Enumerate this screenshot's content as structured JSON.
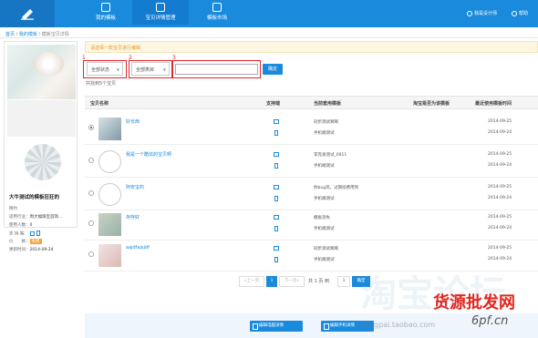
{
  "nav": {
    "items": [
      {
        "label": "我的模板"
      },
      {
        "label": "宝贝详情管理"
      },
      {
        "label": "模板市场"
      }
    ],
    "right": [
      {
        "label": "我是设计师"
      },
      {
        "label": "帮助"
      }
    ]
  },
  "breadcrumb": {
    "items": [
      "首页",
      "我的模板",
      "模板宝贝详情"
    ],
    "sep": "/"
  },
  "template_card": {
    "title": "大牛测试的模板狂狂的",
    "subtitle": "简约",
    "meta": [
      {
        "label": "适用行业：",
        "value": "周大福珠宝首饰..."
      },
      {
        "label": "使用人数：",
        "value": "0"
      },
      {
        "label": "支 持 端：",
        "value": ""
      },
      {
        "label": "价　　格：",
        "value": "免费"
      },
      {
        "label": "更新时间：",
        "value": "2014-09-24"
      }
    ]
  },
  "notice": "请选择一款宝贝进行编辑",
  "filters": {
    "status": "全部状态",
    "category": "全部类目",
    "search_placeholder": "",
    "ok_label": "确定",
    "annotations": [
      "1",
      "2",
      "3"
    ]
  },
  "count_text": "共找到5个宝贝",
  "table": {
    "headers": [
      "宝贝名称",
      "支持端",
      "当前套用模板",
      "淘宝是否为该模板",
      "最近使用模板时间"
    ],
    "rows": [
      {
        "name": "好长西",
        "selected": true,
        "tpl_pc": "同步测试啊啊",
        "tpl_mobile": "手机端测试",
        "date_pc": "2014-09-25",
        "date_mobile": "2014-09-24"
      },
      {
        "name": "我是一个酷炫的宝贝啊",
        "selected": false,
        "tpl_pc": "李克发测试_0911",
        "tpl_mobile": "手机端测试",
        "date_pc": "2014-09-25",
        "date_mobile": "2014-09-24"
      },
      {
        "name": "阿安宝的",
        "selected": false,
        "tpl_pc": "你bug玩，过期续费用到",
        "tpl_mobile": "手机端测试",
        "date_pc": "2014-09-25",
        "date_mobile": "2014-09-24"
      },
      {
        "name": "存存好",
        "selected": false,
        "tpl_pc": "模板消失",
        "tpl_mobile": "手机端测试",
        "date_pc": "2014-09-25",
        "date_mobile": "2014-09-24"
      },
      {
        "name": "aajdfajsjdf",
        "selected": false,
        "tpl_pc": "同步测试啊啊",
        "tpl_mobile": "手机端测试",
        "date_pc": "2014-09-25",
        "date_mobile": "2014-09-24"
      }
    ]
  },
  "pager": {
    "prev": "«上一页",
    "current": "1",
    "next": "下一页»",
    "total": "共 1 页 到",
    "goto_value": "1",
    "go_label": "确定"
  },
  "bottom": {
    "pc_button": "编辑电脑详情",
    "mobile_button": "编辑手机详情"
  },
  "watermarks": {
    "big": "淘宝论坛",
    "red": "货源批发网",
    "url": "6pf.cn",
    "small": "bangpai.taobao.com"
  },
  "colors": {
    "primary": "#1a8bdc",
    "red_annotation": "#e3262b",
    "notice_text": "#e59a1c"
  }
}
